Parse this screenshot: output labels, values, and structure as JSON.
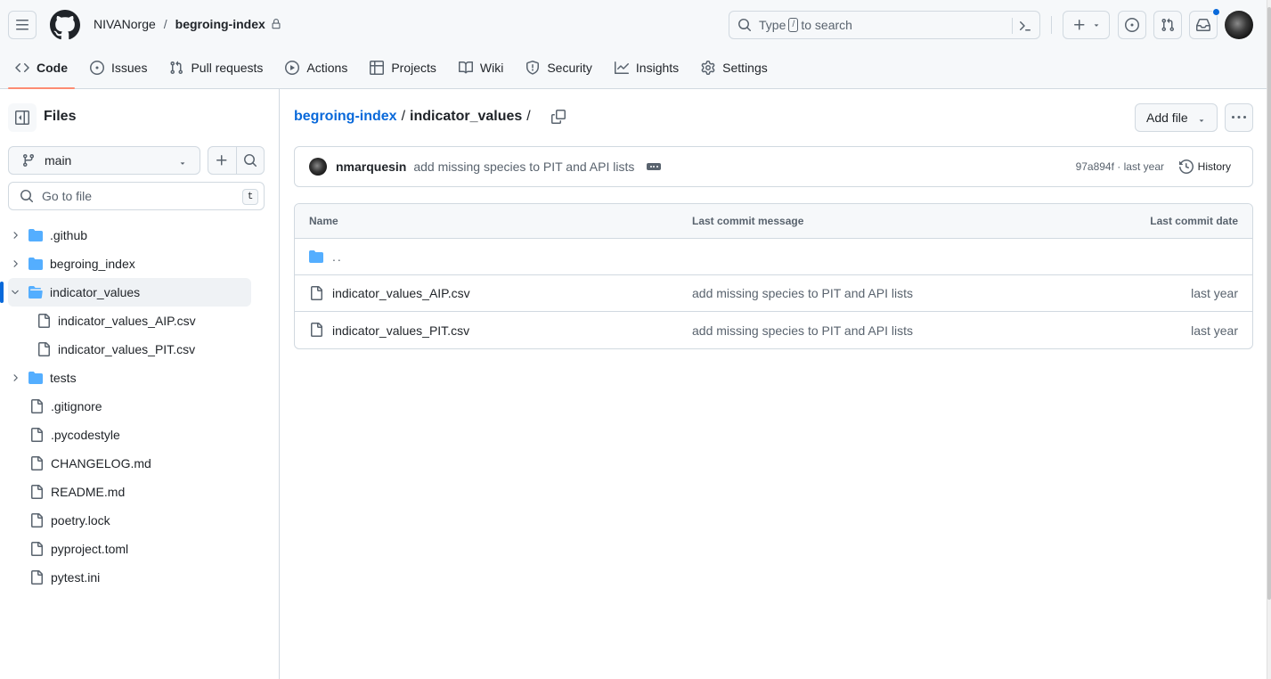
{
  "header": {
    "owner": "NIVANorge",
    "repo": "begroing-index",
    "visibility_icon": "lock-icon",
    "search_placeholder_pre": "Type",
    "search_key": "/",
    "search_placeholder_post": "to search",
    "has_notification": true
  },
  "tabs": [
    {
      "label": "Code",
      "icon": "code-icon",
      "active": true
    },
    {
      "label": "Issues",
      "icon": "issue-icon"
    },
    {
      "label": "Pull requests",
      "icon": "pull-request-icon"
    },
    {
      "label": "Actions",
      "icon": "play-icon"
    },
    {
      "label": "Projects",
      "icon": "table-icon"
    },
    {
      "label": "Wiki",
      "icon": "book-icon"
    },
    {
      "label": "Security",
      "icon": "shield-icon"
    },
    {
      "label": "Insights",
      "icon": "graph-icon"
    },
    {
      "label": "Settings",
      "icon": "gear-icon"
    }
  ],
  "sidebar": {
    "title": "Files",
    "branch": "main",
    "goto_placeholder": "Go to file",
    "goto_shortcut": "t",
    "tree": [
      {
        "label": ".github",
        "type": "folder",
        "expanded": false
      },
      {
        "label": "begroing_index",
        "type": "folder",
        "expanded": false
      },
      {
        "label": "indicator_values",
        "type": "folder",
        "expanded": true,
        "selected": true
      },
      {
        "label": "indicator_values_AIP.csv",
        "type": "file",
        "depth": 1
      },
      {
        "label": "indicator_values_PIT.csv",
        "type": "file",
        "depth": 1
      },
      {
        "label": "tests",
        "type": "folder",
        "expanded": false
      },
      {
        "label": ".gitignore",
        "type": "file"
      },
      {
        "label": ".pycodestyle",
        "type": "file"
      },
      {
        "label": "CHANGELOG.md",
        "type": "file"
      },
      {
        "label": "README.md",
        "type": "file"
      },
      {
        "label": "poetry.lock",
        "type": "file"
      },
      {
        "label": "pyproject.toml",
        "type": "file"
      },
      {
        "label": "pytest.ini",
        "type": "file"
      }
    ]
  },
  "main": {
    "breadcrumb": {
      "root": "begroing-index",
      "separator": "/",
      "current": "indicator_values",
      "trailing": "/"
    },
    "add_file_label": "Add file",
    "latest_commit": {
      "author": "nmarquesin",
      "message": "add missing species to PIT and API lists",
      "sha": "97a894f",
      "meta_separator": "·",
      "when": "last year",
      "history_label": "History"
    },
    "table": {
      "headers": {
        "name": "Name",
        "message": "Last commit message",
        "date": "Last commit date"
      },
      "parent_label": "..",
      "rows": [
        {
          "name": "indicator_values_AIP.csv",
          "message": "add missing species to PIT and API lists",
          "date": "last year"
        },
        {
          "name": "indicator_values_PIT.csv",
          "message": "add missing species to PIT and API lists",
          "date": "last year"
        }
      ]
    }
  },
  "colors": {
    "accent": "#0969da",
    "tab_underline": "#fd8c73",
    "folder": "#54aeff",
    "muted_text": "#59636e",
    "border": "#d1d9e0"
  }
}
